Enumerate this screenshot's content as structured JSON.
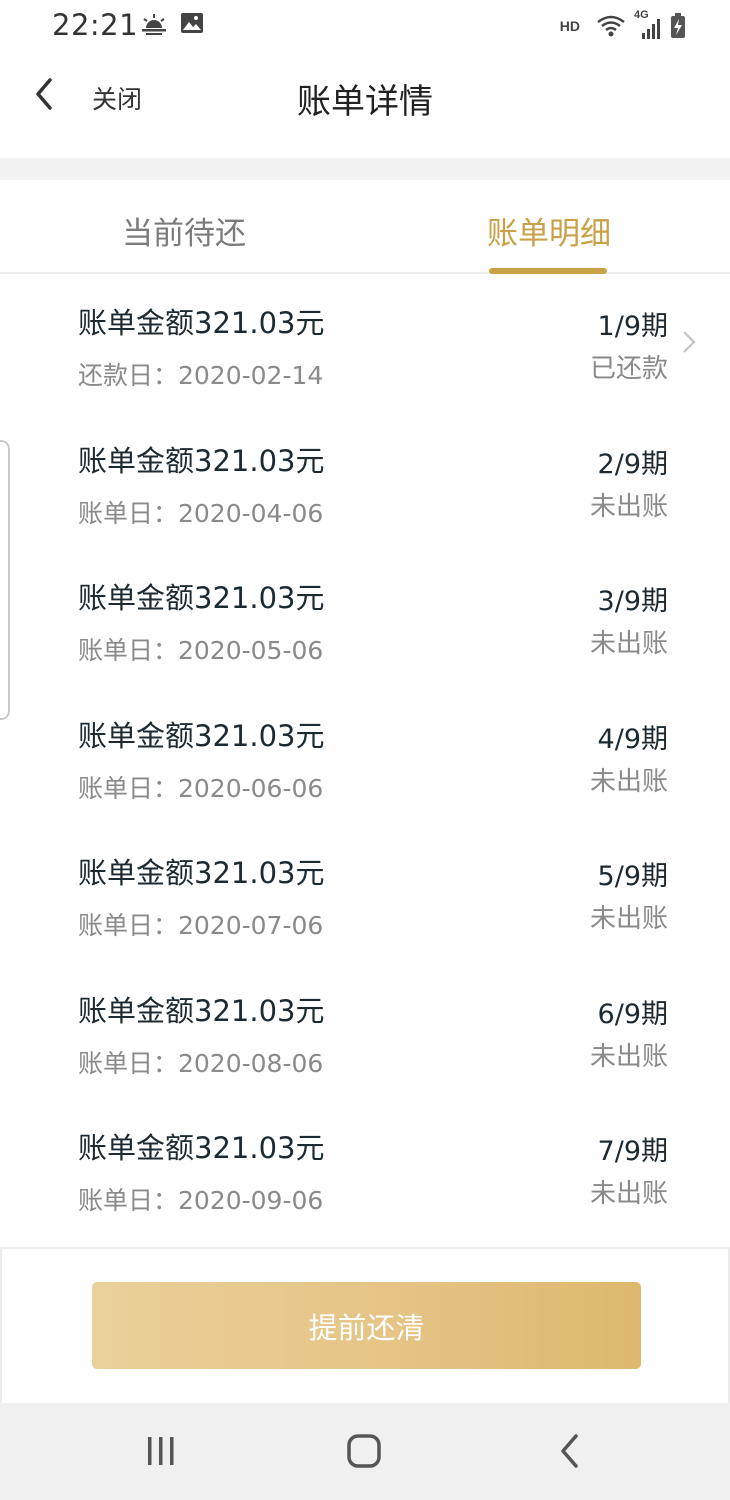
{
  "status_bar": {
    "time": "22:21",
    "network_hd": "HD",
    "network_type": "4G",
    "icons": [
      "sunrise-weather-icon",
      "image-notification-icon",
      "wifi-icon",
      "signal-icon",
      "battery-charging-icon"
    ]
  },
  "header": {
    "back_icon": "chevron-left-icon",
    "close_label": "关闭",
    "title": "账单详情"
  },
  "tabs": [
    {
      "label": "当前待还",
      "active": false
    },
    {
      "label": "账单明细",
      "active": true
    }
  ],
  "bills": [
    {
      "amount": "账单金额321.03元",
      "date": "还款日：2020-02-14",
      "period": "1/9期",
      "status": "已还款",
      "has_arrow": true
    },
    {
      "amount": "账单金额321.03元",
      "date": "账单日：2020-04-06",
      "period": "2/9期",
      "status": "未出账",
      "has_arrow": false
    },
    {
      "amount": "账单金额321.03元",
      "date": "账单日：2020-05-06",
      "period": "3/9期",
      "status": "未出账",
      "has_arrow": false
    },
    {
      "amount": "账单金额321.03元",
      "date": "账单日：2020-06-06",
      "period": "4/9期",
      "status": "未出账",
      "has_arrow": false
    },
    {
      "amount": "账单金额321.03元",
      "date": "账单日：2020-07-06",
      "period": "5/9期",
      "status": "未出账",
      "has_arrow": false
    },
    {
      "amount": "账单金额321.03元",
      "date": "账单日：2020-08-06",
      "period": "6/9期",
      "status": "未出账",
      "has_arrow": false
    },
    {
      "amount": "账单金额321.03元",
      "date": "账单日：2020-09-06",
      "period": "7/9期",
      "status": "未出账",
      "has_arrow": false
    }
  ],
  "action": {
    "payoff_label": "提前还清"
  },
  "nav_bar": {
    "icons": [
      "recent-apps-icon",
      "home-icon",
      "back-icon"
    ]
  },
  "colors": {
    "accent": "#c9a146",
    "button_gradient_start": "#ead09a",
    "button_gradient_end": "#ddb86e",
    "muted_text": "#8a8a8a"
  }
}
